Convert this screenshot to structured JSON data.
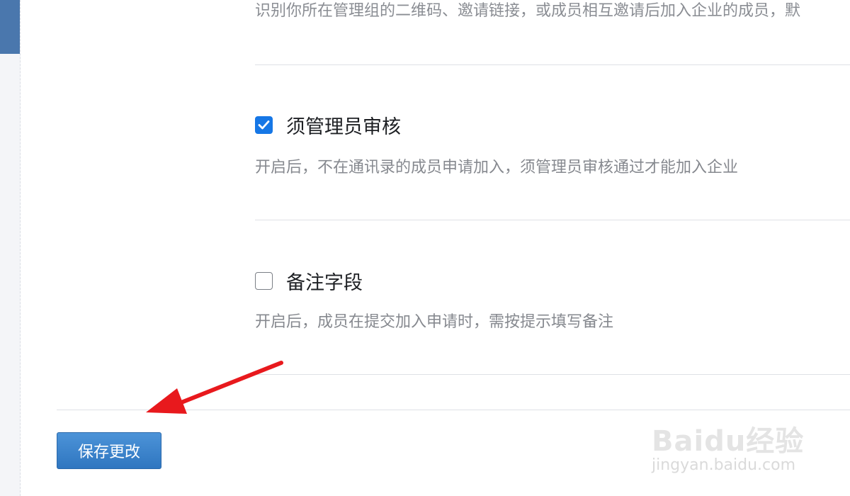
{
  "section": {
    "intro_text": "识别你所在管理组的二维码、邀请链接，或成员相互邀请后加入企业的成员，默",
    "options": [
      {
        "label": "须管理员审核",
        "checked": true,
        "description": "开启后，不在通讯录的成员申请加入，须管理员审核通过才能加入企业"
      },
      {
        "label": "备注字段",
        "checked": false,
        "description": "开启后，成员在提交加入申请时，需按提示填写备注"
      }
    ]
  },
  "footer": {
    "save_label": "保存更改"
  },
  "watermark": {
    "brand": "Baidu经验",
    "url": "jingyan.baidu.com"
  },
  "colors": {
    "accent": "#1677e6",
    "button": "#2f76c0",
    "annotation_arrow": "#e8191d"
  }
}
